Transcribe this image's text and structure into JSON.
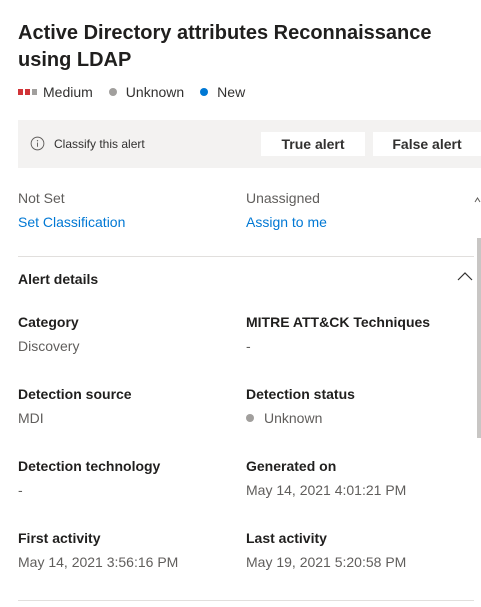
{
  "title": "Active Directory attributes Reconnaissance using LDAP",
  "meta": {
    "severity": {
      "label": "Medium",
      "bar_colors": [
        "#d13438",
        "#d13438",
        "#a19f9d"
      ]
    },
    "determination": {
      "label": "Unknown",
      "dot_color": "#a19f9d"
    },
    "status": {
      "label": "New",
      "dot_color": "#0078d4"
    }
  },
  "classify_bar": {
    "label": "Classify this alert",
    "true_alert": "True alert",
    "false_alert": "False alert"
  },
  "classification": {
    "value": "Not Set",
    "link": "Set Classification"
  },
  "assignment": {
    "value": "Unassigned",
    "link": "Assign to me"
  },
  "details": {
    "heading": "Alert details",
    "category": {
      "label": "Category",
      "value": "Discovery"
    },
    "mitre": {
      "label": "MITRE ATT&CK Techniques",
      "value": "-"
    },
    "detection_source": {
      "label": "Detection source",
      "value": "MDI"
    },
    "detection_status": {
      "label": "Detection status",
      "value": "Unknown"
    },
    "detection_technology": {
      "label": "Detection technology",
      "value": "-"
    },
    "generated_on": {
      "label": "Generated on",
      "value": "May 14, 2021 4:01:21 PM"
    },
    "first_activity": {
      "label": "First activity",
      "value": "May 14, 2021 3:56:16 PM"
    },
    "last_activity": {
      "label": "Last activity",
      "value": "May 19, 2021 5:20:58 PM"
    }
  }
}
